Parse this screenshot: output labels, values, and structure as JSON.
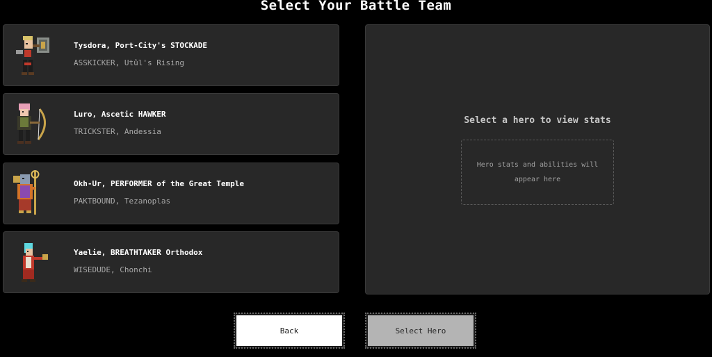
{
  "title": "Select Your Battle Team",
  "heroes": [
    {
      "name": "Tysdora, Port-City's STOCKADE",
      "subtitle": "ASSKICKER, Utûl's Rising",
      "sprite_icon": "warrior-with-hammer-sprite"
    },
    {
      "name": "Luro, Ascetic HAWKER",
      "subtitle": "TRICKSTER, Andessia",
      "sprite_icon": "archer-with-bow-sprite"
    },
    {
      "name": "Okh-Ur, PERFORMER of the Great Temple",
      "subtitle": "PAKTBOUND, Tezanoplas",
      "sprite_icon": "priest-with-staff-sprite"
    },
    {
      "name": "Yaelie, BREATHTAKER Orthodox",
      "subtitle": "WISEDUDE, Chonchi",
      "sprite_icon": "mage-casting-sprite"
    }
  ],
  "stats_panel": {
    "heading": "Select a hero to view stats",
    "placeholder": "Hero stats and abilities will appear here"
  },
  "buttons": {
    "back": "Back",
    "select_hero": "Select Hero"
  }
}
